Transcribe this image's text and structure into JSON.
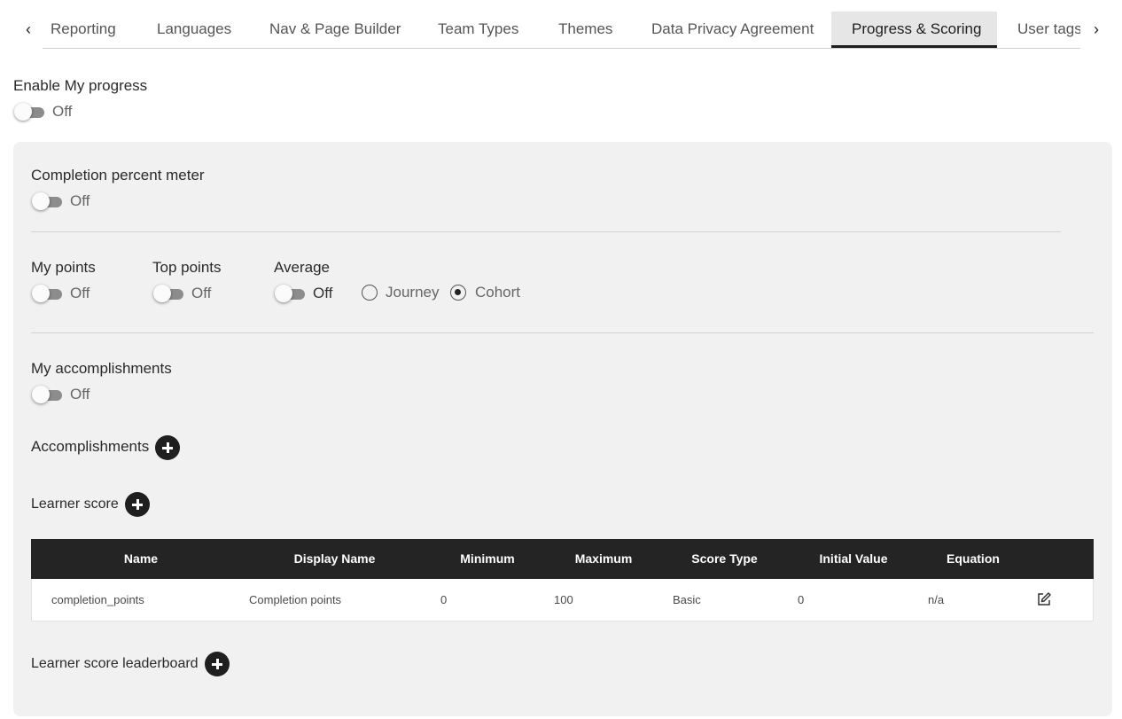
{
  "tabs": {
    "items": [
      {
        "label": "Reporting"
      },
      {
        "label": "Languages"
      },
      {
        "label": "Nav & Page Builder"
      },
      {
        "label": "Team Types"
      },
      {
        "label": "Themes"
      },
      {
        "label": "Data Privacy Agreement"
      },
      {
        "label": "Progress & Scoring",
        "active": true
      },
      {
        "label": "User tags"
      }
    ],
    "prev_icon": "chevron-left-icon",
    "next_icon": "chevron-right-icon"
  },
  "enable_my_progress": {
    "label": "Enable My progress",
    "state": "Off"
  },
  "completion_meter": {
    "label": "Completion percent meter",
    "state": "Off"
  },
  "my_points": {
    "label": "My points",
    "state": "Off"
  },
  "top_points": {
    "label": "Top points",
    "state": "Off"
  },
  "average": {
    "label": "Average",
    "state": "Off",
    "options": [
      {
        "label": "Journey",
        "checked": false
      },
      {
        "label": "Cohort",
        "checked": true
      }
    ]
  },
  "my_accomplishments": {
    "label": "My accomplishments",
    "state": "Off"
  },
  "accomplishments": {
    "label": "Accomplishments",
    "add_icon": "plus-circle-icon"
  },
  "learner_score": {
    "label": "Learner score",
    "add_icon": "plus-circle-icon",
    "columns": [
      "Name",
      "Display Name",
      "Minimum",
      "Maximum",
      "Score Type",
      "Initial Value",
      "Equation"
    ],
    "rows": [
      {
        "name": "completion_points",
        "display_name": "Completion points",
        "minimum": "0",
        "maximum": "100",
        "score_type": "Basic",
        "initial_value": "0",
        "equation": "n/a",
        "action_icon": "edit-icon"
      }
    ]
  },
  "leaderboard": {
    "label": "Learner score leaderboard",
    "add_icon": "plus-circle-icon"
  }
}
